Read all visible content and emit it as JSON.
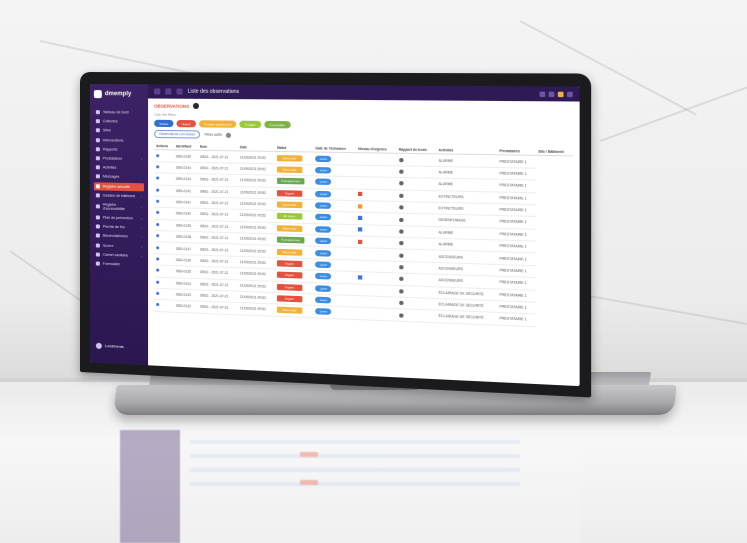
{
  "app": {
    "brand": "dmemply",
    "window_title": "Liste des observations"
  },
  "sidebar": {
    "items": [
      {
        "label": "Tableau de bord",
        "active": false,
        "expand": false
      },
      {
        "label": "Collectes",
        "active": false,
        "expand": false
      },
      {
        "label": "Sites",
        "active": false,
        "expand": false
      },
      {
        "label": "Interventions",
        "active": false,
        "expand": false
      },
      {
        "label": "Rapports",
        "active": false,
        "expand": false
      },
      {
        "label": "Prestataires",
        "active": false,
        "expand": true
      },
      {
        "label": "Activités",
        "active": false,
        "expand": false
      },
      {
        "label": "Messages",
        "active": false,
        "expand": false
      },
      {
        "label": "Registre sécurité",
        "active": true,
        "expand": true
      },
      {
        "label": "Gestion de bâtiment",
        "active": false,
        "expand": true
      },
      {
        "label": "Registre d'accessibilité",
        "active": false,
        "expand": true
      },
      {
        "label": "Plan de prévention",
        "active": false,
        "expand": true
      },
      {
        "label": "Permis de feu",
        "active": false,
        "expand": true
      },
      {
        "label": "Bénévolat/orion",
        "active": false,
        "expand": true
      },
      {
        "label": "Scorre",
        "active": false,
        "expand": true
      },
      {
        "label": "Carnet sanitaire",
        "active": false,
        "expand": true
      },
      {
        "label": "Formulaire",
        "active": false,
        "expand": false
      }
    ],
    "footer_label": "Lundimeras"
  },
  "content": {
    "section_title": "OBSERVATIONS",
    "subtitle": "Liste des filtres",
    "chips": [
      {
        "label": "Toutes",
        "color": "#2f6fd0"
      },
      {
        "label": "Urgent",
        "color": "#e2523f"
      },
      {
        "label": "À traiter rapidement",
        "color": "#f2b23a"
      },
      {
        "label": "À traiter",
        "color": "#9ac93b"
      },
      {
        "label": "À surveiller",
        "color": "#7cb342"
      }
    ],
    "filter_pill": "Observations non levées",
    "filter_link": "Filtres actifs"
  },
  "table": {
    "headers": [
      "Actions",
      "Identifiant",
      "Nom",
      "Date",
      "Statut",
      "Date de l'échéance",
      "Niveau d'urgence",
      "Rapport de levée",
      "Activités",
      "Prestataires",
      "Site / Bâtiment"
    ],
    "rows": [
      {
        "id": "OBS-0145",
        "name": "OBS1 - 2021-07-21",
        "date": "21/09/2021 09:52",
        "status": "Sans suite",
        "status_color": "#f2b23a",
        "action": "Lever",
        "severity": "",
        "activity": "ALARME",
        "provider": "PRESTATAIRE 1"
      },
      {
        "id": "OBS-0144",
        "name": "OBS1 - 2021-07-21",
        "date": "21/09/2021 09:52",
        "status": "Sans suite",
        "status_color": "#f2b23a",
        "action": "Lever",
        "severity": "",
        "activity": "ALARME",
        "provider": "PRESTATAIRE 1"
      },
      {
        "id": "OBS-0143",
        "name": "OBS1 - 2021-07-21",
        "date": "21/09/2021 09:52",
        "status": "À programmer",
        "status_color": "#6aa84f",
        "action": "Lever",
        "severity": "",
        "activity": "ALARME",
        "provider": "PRESTATAIRE 1"
      },
      {
        "id": "OBS-0142",
        "name": "OBS1 - 2021-07-21",
        "date": "21/09/2021 09:52",
        "status": "Urgent",
        "status_color": "#e2523f",
        "action": "Lever",
        "severity": "red",
        "activity": "EXTINCTEURS",
        "provider": "PRESTATAIRE 1"
      },
      {
        "id": "OBS-0141",
        "name": "OBS1 - 2021-07-21",
        "date": "21/09/2021 09:52",
        "status": "Sans suite",
        "status_color": "#f2b23a",
        "action": "Lever",
        "severity": "orange",
        "activity": "EXTINCTEURS",
        "provider": "PRESTATAIRE 1"
      },
      {
        "id": "OBS-0140",
        "name": "OBS1 - 2021-07-21",
        "date": "21/09/2021 09:52",
        "status": "En cours",
        "status_color": "#9ac93b",
        "action": "Lever",
        "severity": "blue",
        "activity": "DESENFUMAGE",
        "provider": "PRESTATAIRE 1"
      },
      {
        "id": "OBS-0139",
        "name": "OBS1 - 2021-07-21",
        "date": "21/09/2021 09:52",
        "status": "Sans suite",
        "status_color": "#f2b23a",
        "action": "Lever",
        "severity": "blue",
        "activity": "ALARME",
        "provider": "PRESTATAIRE 1"
      },
      {
        "id": "OBS-0138",
        "name": "OBS1 - 2021-07-21",
        "date": "21/09/2021 09:52",
        "status": "À programmer",
        "status_color": "#6aa84f",
        "action": "Lever",
        "severity": "red",
        "activity": "ALARME",
        "provider": "PRESTATAIRE 1"
      },
      {
        "id": "OBS-0137",
        "name": "OBS1 - 2021-07-21",
        "date": "21/09/2021 09:52",
        "status": "Sans suite",
        "status_color": "#f2b23a",
        "action": "Lever",
        "severity": "",
        "activity": "ASCENSEURS",
        "provider": "PRESTATAIRE 1"
      },
      {
        "id": "OBS-0136",
        "name": "OBS1 - 2021-07-21",
        "date": "21/09/2021 09:52",
        "status": "Urgent",
        "status_color": "#e2523f",
        "action": "Lever",
        "severity": "",
        "activity": "ASCENSEURS",
        "provider": "PRESTATAIRE 1"
      },
      {
        "id": "OBS-0135",
        "name": "OBS1 - 2021-07-21",
        "date": "21/09/2021 09:52",
        "status": "Urgent",
        "status_color": "#e2523f",
        "action": "Lever",
        "severity": "blue",
        "activity": "ASCENSEURS",
        "provider": "PRESTATAIRE 1"
      },
      {
        "id": "OBS-0134",
        "name": "OBS1 - 2021-07-21",
        "date": "21/09/2021 09:52",
        "status": "Urgent",
        "status_color": "#e2523f",
        "action": "Lever",
        "severity": "",
        "activity": "ÉCLAIRAGE DE SÉCURITÉ",
        "provider": "PRESTATAIRE 1"
      },
      {
        "id": "OBS-0133",
        "name": "OBS1 - 2021-07-21",
        "date": "21/09/2021 09:52",
        "status": "Urgent",
        "status_color": "#e2523f",
        "action": "Lever",
        "severity": "",
        "activity": "ÉCLAIRAGE DE SÉCURITÉ",
        "provider": "PRESTATAIRE 1"
      },
      {
        "id": "OBS-0132",
        "name": "OBS1 - 2021-07-21",
        "date": "21/09/2021 09:52",
        "status": "Sans suite",
        "status_color": "#f2b23a",
        "action": "Lever",
        "severity": "",
        "activity": "ÉCLAIRAGE DE SÉCURITÉ",
        "provider": "PRESTATAIRE 1"
      }
    ]
  }
}
